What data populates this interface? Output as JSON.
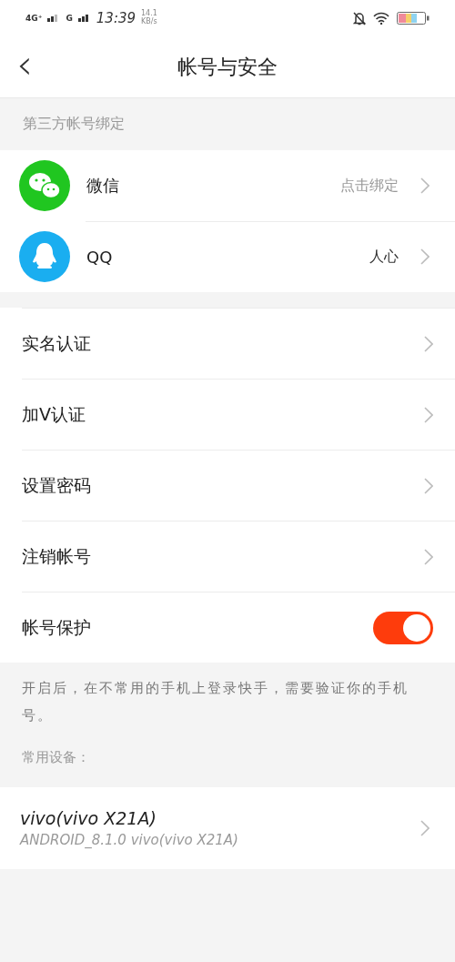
{
  "status_bar": {
    "network_1": "4G⁺",
    "network_2": "G",
    "time": "13:39",
    "speed_value": "14.1",
    "speed_unit": "KB/s"
  },
  "header": {
    "back": "‹",
    "title": "帐号与安全"
  },
  "third_party": {
    "heading": "第三方帐号绑定",
    "items": [
      {
        "kind": "wechat",
        "label": "微信",
        "value": "点击绑定",
        "value_muted": true
      },
      {
        "kind": "qq",
        "label": "QQ",
        "value": "人心",
        "value_muted": false
      }
    ]
  },
  "settings": [
    {
      "kind": "link",
      "label": "实名认证"
    },
    {
      "kind": "link",
      "label": "加V认证"
    },
    {
      "kind": "link",
      "label": "设置密码"
    },
    {
      "kind": "link",
      "label": "注销帐号"
    },
    {
      "kind": "toggle",
      "label": "帐号保护",
      "on": true
    }
  ],
  "protection_note": "开启后，在不常用的手机上登录快手，需要验证你的手机号。",
  "devices": {
    "heading": "常用设备：",
    "items": [
      {
        "name": "vivo(vivo X21A)",
        "detail": "ANDROID_8.1.0 vivo(vivo X21A)"
      }
    ]
  }
}
